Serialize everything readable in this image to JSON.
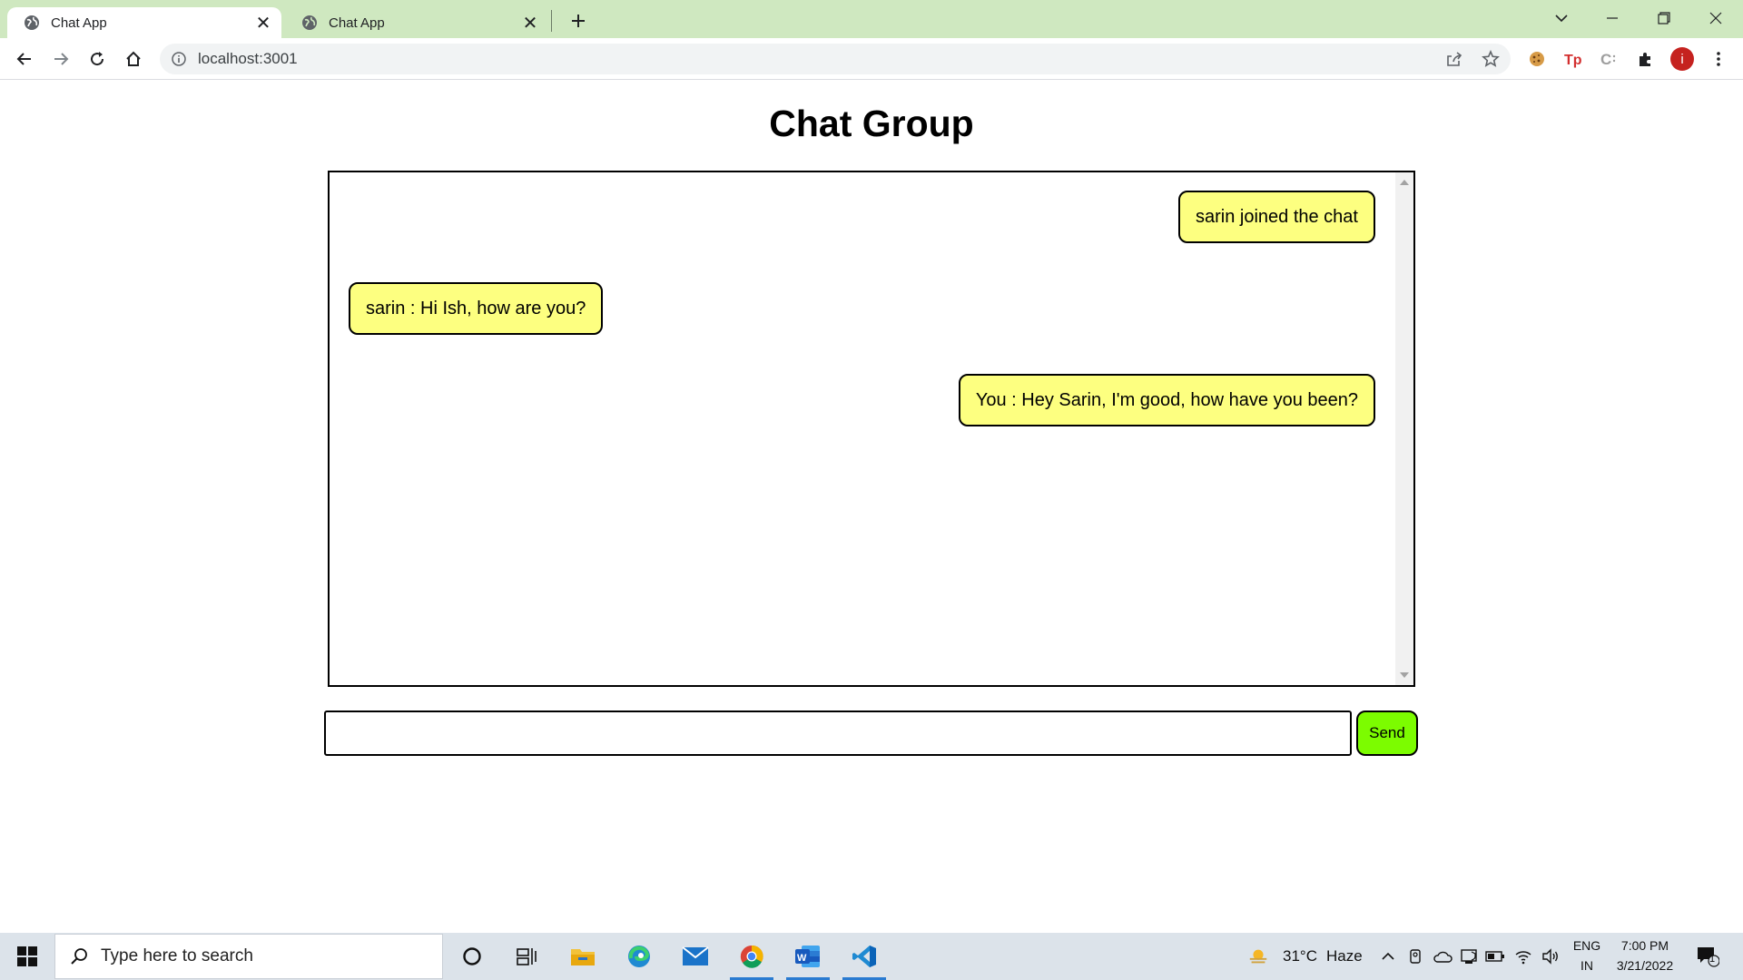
{
  "browser": {
    "tabs": [
      {
        "title": "Chat App",
        "active": true
      },
      {
        "title": "Chat App",
        "active": false
      }
    ],
    "url": "localhost:3001",
    "profile_initial": "i",
    "extensions": [
      "cookie-icon",
      "tp-icon",
      "c-icon",
      "puzzle-icon"
    ]
  },
  "page": {
    "heading": "Chat Group",
    "messages": [
      {
        "text": "sarin joined the chat",
        "side": "right"
      },
      {
        "text": "sarin : Hi Ish, how are you?",
        "side": "left"
      },
      {
        "text": "You : Hey Sarin, I'm good, how have you been?",
        "side": "right"
      }
    ],
    "input_value": "",
    "send_label": "Send",
    "colors": {
      "bubble": "#fdff80",
      "send_button": "#7cfc00"
    }
  },
  "taskbar": {
    "search_placeholder": "Type here to search",
    "weather_temp": "31°C",
    "weather_desc": "Haze",
    "lang_top": "ENG",
    "lang_bottom": "IN",
    "time": "7:00 PM",
    "date": "3/21/2022",
    "notification_count": "1"
  }
}
